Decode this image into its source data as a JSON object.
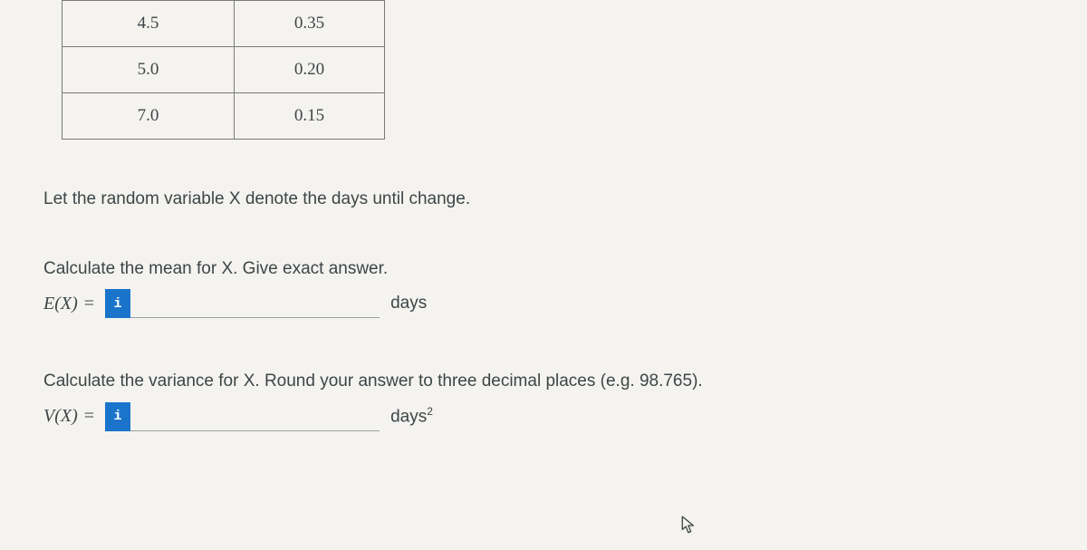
{
  "chart_data": {
    "type": "table",
    "rows": [
      {
        "x": "4.5",
        "p": "0.35"
      },
      {
        "x": "5.0",
        "p": "0.20"
      },
      {
        "x": "7.0",
        "p": "0.15"
      }
    ]
  },
  "intro": "Let the random variable X denote the days until change.",
  "q1": {
    "prompt": "Calculate the mean for X. Give exact answer.",
    "label": "E(X) =",
    "unit": "days",
    "value": ""
  },
  "q2": {
    "prompt": "Calculate the variance for X. Round your answer to three decimal places (e.g. 98.765).",
    "label": "V(X) =",
    "unit_base": "days",
    "unit_exp": "2",
    "value": ""
  }
}
